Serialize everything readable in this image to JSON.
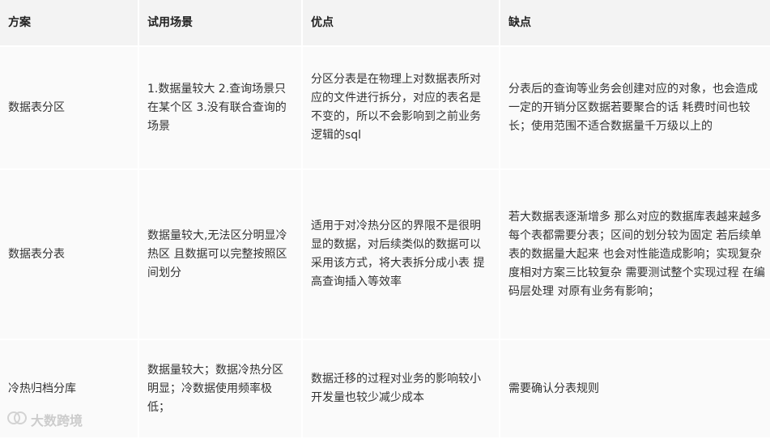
{
  "table": {
    "headers": [
      "方案",
      "试用场景",
      "优点",
      "缺点"
    ],
    "rows": [
      {
        "scheme": "数据表分区",
        "scenario": "1.数据量较大 2.查询场景只在某个区 3.没有联合查询的场景",
        "pros": "分区分表是在物理上对数据表所对应的文件进行拆分，对应的表名是不变的，所以不会影响到之前业务逻辑的sql",
        "cons": "分表后的查询等业务会创建对应的对象，也会造成一定的开销分区数据若要聚合的话 耗费时间也较长；使用范围不适合数据量千万级以上的"
      },
      {
        "scheme": "数据表分表",
        "scenario": "数据量较大,无法区分明显冷热区  且数据可以完整按照区间划分",
        "pros": "适用于对冷热分区的界限不是很明显的数据，对后续类似的数据可以采用该方式，将大表拆分成小表 提高查询插入等效率",
        "cons": "若大数据表逐渐增多 那么对应的数据库表越来越多 每个表都需要分表；区间的划分较为固定 若后续单表的数据量大起来 也会对性能造成影响；实现复杂度相对方案三比较复杂  需要测试整个实现过程 在编码层处理 对原有业务有影响；"
      },
      {
        "scheme": "冷热归档分库",
        "scenario": "数据量较大；数据冷热分区明显；冷数据使用频率极低；",
        "pros": "数据迁移的过程对业务的影响较小 开发量也较少减少成本",
        "cons": "需要确认分表规则"
      }
    ]
  },
  "watermark": {
    "text": "大数跨境",
    "icon": "logo-icon"
  }
}
